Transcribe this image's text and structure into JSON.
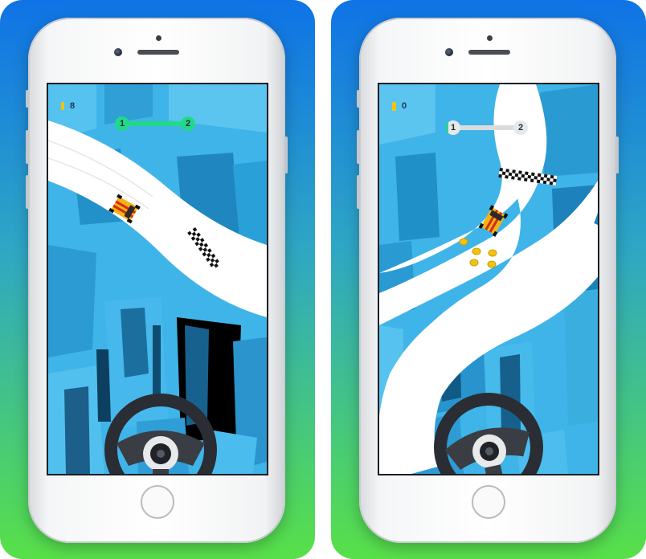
{
  "colors": {
    "panel_left_top": "#0f73e6",
    "panel_left_bottom": "#58e048",
    "sky_blue": "#38aee3",
    "road": "#ffffff",
    "progress_active": "#22d98a",
    "progress_inactive": "#d9dcdf",
    "coin": "#f2c40f",
    "car_body": "#f3b412",
    "car_stripe": "#d8281a"
  },
  "screens": [
    {
      "coin_icon": "coin-icon",
      "coin_count": "8",
      "level_progress": {
        "start_level": "1",
        "end_level": "2",
        "fraction": 1.0
      }
    },
    {
      "coin_icon": "coin-icon",
      "coin_count": "0",
      "level_progress": {
        "start_level": "1",
        "end_level": "2",
        "fraction": 0.05
      }
    }
  ],
  "controls": {
    "steering_wheel_icon": "steering-wheel-icon",
    "home_button_icon": "home-button-icon"
  }
}
